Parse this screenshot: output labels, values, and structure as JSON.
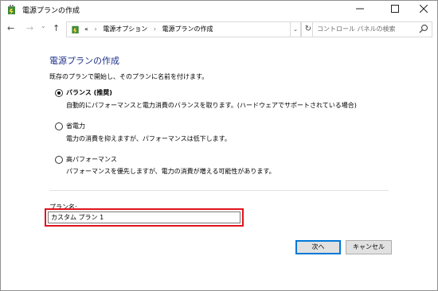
{
  "window": {
    "title": "電源プランの作成",
    "min_icon": "minimize-icon",
    "max_icon": "maximize-icon",
    "close_icon": "close-icon"
  },
  "address_bar": {
    "overflow": "«",
    "crumbs": [
      "電源オプション",
      "電源プランの作成"
    ],
    "separator": "›",
    "search_placeholder": "コントロール パネルの検索"
  },
  "content": {
    "heading": "電源プランの作成",
    "intro": "既存のプランで開始し、そのプランに名前を付けます。",
    "options": [
      {
        "label": "バランス (推奨)",
        "desc": "自動的にパフォーマンスと電力消費のバランスを取ります。(ハードウェアでサポートされている場合)",
        "selected": true
      },
      {
        "label": "省電力",
        "desc": "電力の消費を抑えますが、パフォーマンスは低下します。",
        "selected": false
      },
      {
        "label": "高パフォーマンス",
        "desc": "パフォーマンスを優先しますが、電力の消費が増える可能性があります。",
        "selected": false
      }
    ],
    "plan_name_label": "プラン名:",
    "plan_name_value": "カスタム プラン 1"
  },
  "buttons": {
    "next": "次へ",
    "cancel": "キャンセル"
  },
  "colors": {
    "heading": "#1e3287",
    "highlight": "#e0141e",
    "accent": "#0078d7"
  }
}
